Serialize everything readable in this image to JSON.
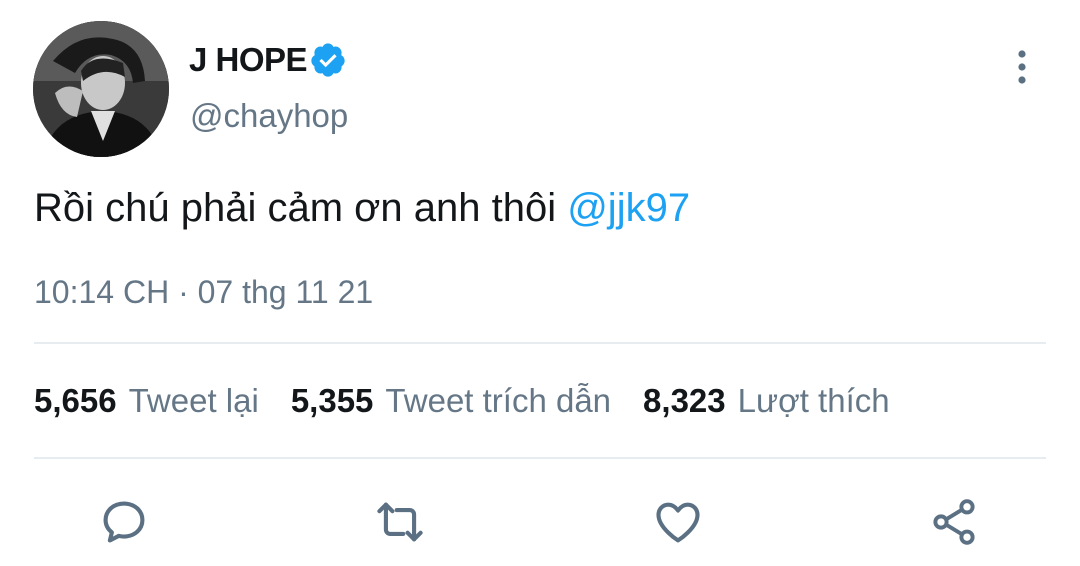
{
  "author": {
    "display_name": "J HOPE",
    "handle": "@chayhop",
    "verified": true
  },
  "tweet": {
    "text": "Rồi chú phải cảm ơn anh thôi ",
    "mention": "@jjk97",
    "timestamp": "10:14 CH · 07 thg 11 21"
  },
  "stats": [
    {
      "count": "5,656",
      "label": "Tweet lại"
    },
    {
      "count": "5,355",
      "label": "Tweet trích dẫn"
    },
    {
      "count": "8,323",
      "label": "Lượt thích"
    }
  ],
  "actions": [
    {
      "icon": "reply-icon"
    },
    {
      "icon": "retweet-icon"
    },
    {
      "icon": "like-heart-icon"
    },
    {
      "icon": "share-icon"
    }
  ],
  "colors": {
    "accent": "#1da1f2",
    "text_primary": "#14171a",
    "text_secondary": "#657786",
    "icon": "#5b7083",
    "divider": "#e6ecf0"
  }
}
